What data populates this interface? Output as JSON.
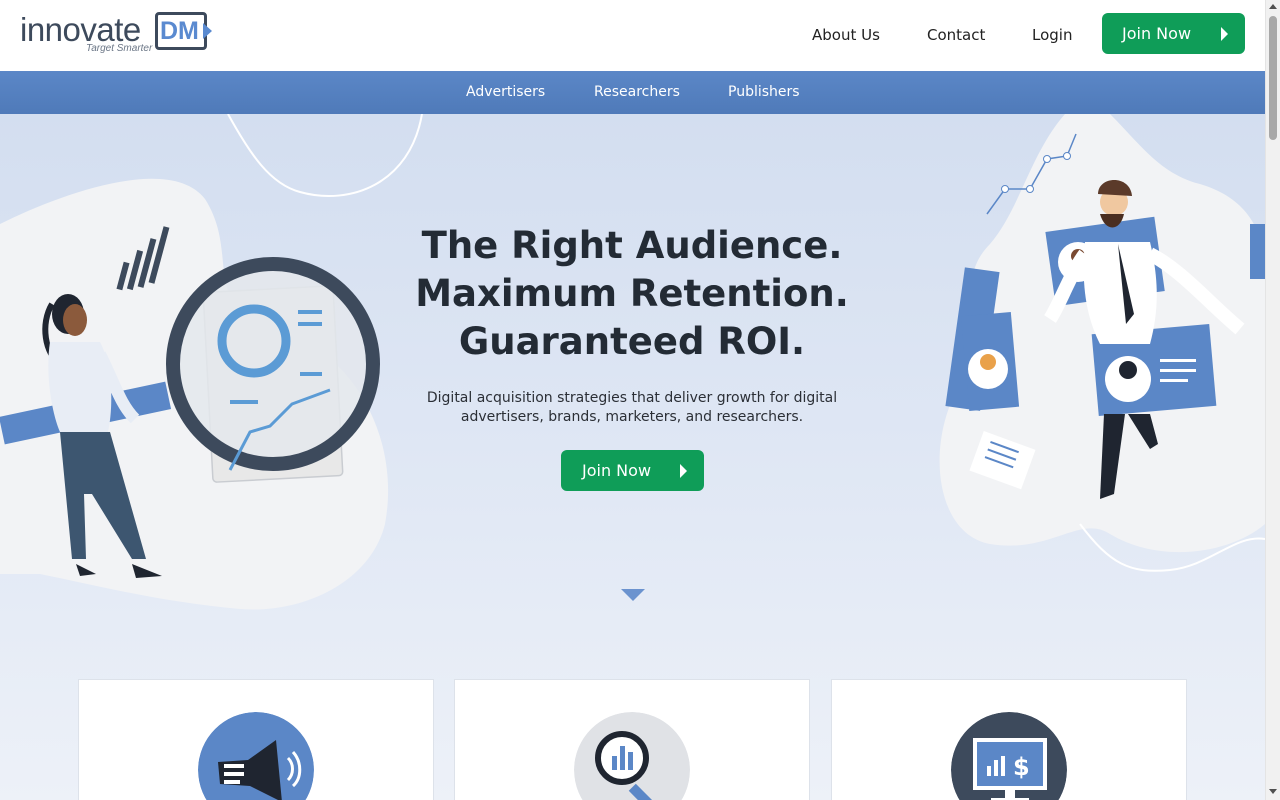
{
  "header": {
    "logo_text": "innovate",
    "logo_mark": "DM",
    "logo_tagline": "Target Smarter",
    "nav": [
      {
        "label": "About Us"
      },
      {
        "label": "Contact"
      },
      {
        "label": "Login"
      }
    ],
    "join_label": "Join Now"
  },
  "subnav": {
    "items": [
      {
        "label": "Advertisers"
      },
      {
        "label": "Researchers"
      },
      {
        "label": "Publishers"
      }
    ]
  },
  "hero": {
    "title_lines": [
      "The Right Audience.",
      "Maximum Retention.",
      "Guaranteed ROI."
    ],
    "subtitle": "Digital acquisition strategies that deliver growth for digital advertisers, brands, marketers, and researchers.",
    "cta_label": "Join Now"
  },
  "cards": [
    {
      "icon": "megaphone-icon"
    },
    {
      "icon": "magnify-chart-icon"
    },
    {
      "icon": "monitor-dollar-icon"
    }
  ],
  "colors": {
    "accent_green": "#0f9d58",
    "subnav_blue": "#5b87c7",
    "hero_bg": "#d3def0",
    "dark_navy": "#3d4a5c"
  }
}
